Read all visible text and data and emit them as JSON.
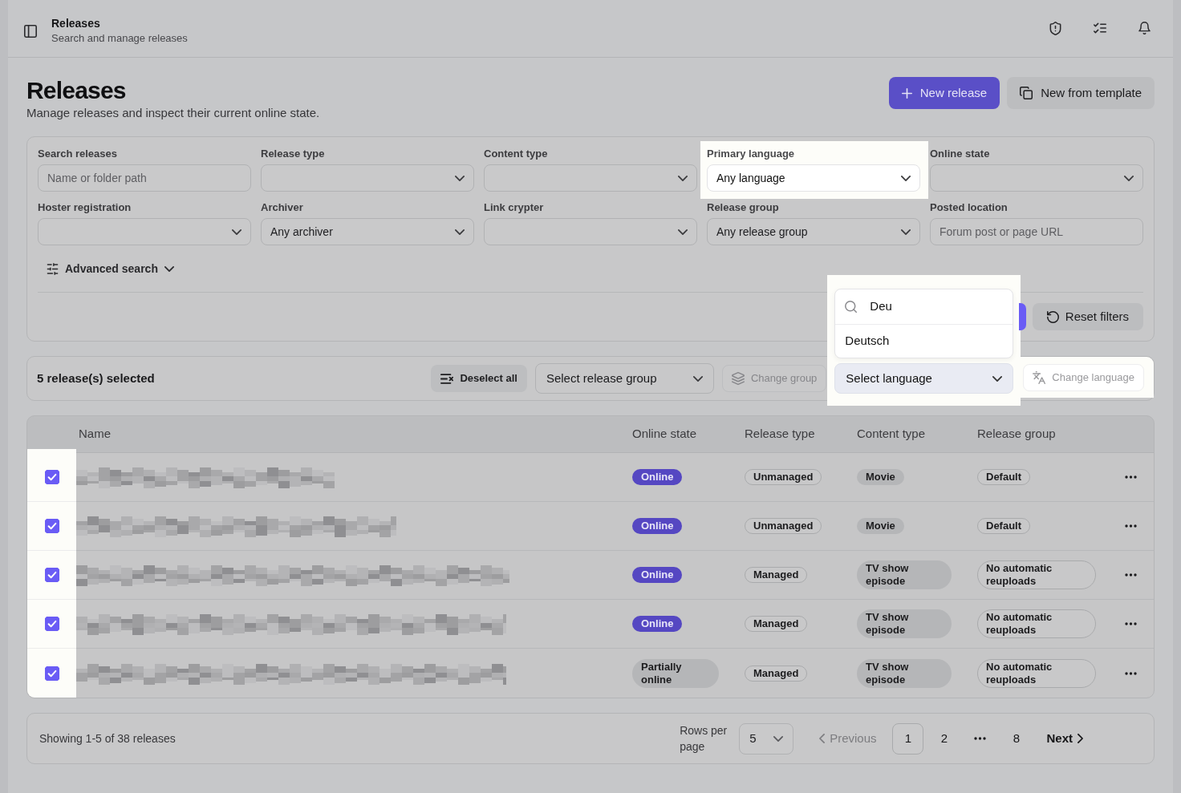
{
  "header": {
    "title": "Releases",
    "subtitle": "Search and manage releases"
  },
  "page": {
    "title": "Releases",
    "description": "Manage releases and inspect their current online state.",
    "actions": [
      {
        "kind": "primary",
        "label": "New release"
      },
      {
        "kind": "secondary",
        "label": "New from template"
      }
    ]
  },
  "filters": {
    "fields": [
      {
        "label": "Search releases",
        "kind": "text",
        "placeholder": "Name or folder path",
        "highlighted": false
      },
      {
        "label": "Release type",
        "kind": "select",
        "highlighted": false
      },
      {
        "label": "Content type",
        "kind": "select",
        "highlighted": false
      },
      {
        "label": "Primary language",
        "kind": "select",
        "value": "Any language",
        "highlighted": true
      },
      {
        "label": "Online state",
        "kind": "select",
        "highlighted": false
      },
      {
        "label": "Hoster registration",
        "kind": "select",
        "highlighted": false
      },
      {
        "label": "Archiver",
        "kind": "select",
        "value": "Any archiver",
        "highlighted": false
      },
      {
        "label": "Link crypter",
        "kind": "select",
        "highlighted": false
      },
      {
        "label": "Release group",
        "kind": "select",
        "value": "Any release group",
        "highlighted": false
      },
      {
        "label": "Posted location",
        "kind": "text",
        "placeholder": "Forum post or page URL",
        "highlighted": false
      }
    ],
    "advanced_search": {
      "label": "Advanced search",
      "expanded": false
    },
    "reset_button": "Reset filters"
  },
  "bulk_bar": {
    "selection_text": "5 release(s) selected",
    "actions": [
      {
        "kind": "button",
        "label": "Deselect all",
        "disabled": false,
        "highlighted": false
      },
      {
        "kind": "select",
        "value": "Select release group",
        "highlighted": false
      },
      {
        "kind": "button",
        "label": "Change group",
        "disabled": true,
        "highlighted": false
      },
      {
        "kind": "select",
        "value": "Select language",
        "highlighted": true,
        "dropdown": {
          "search": "Deu",
          "options": [
            "Deutsch"
          ]
        }
      },
      {
        "kind": "button",
        "label": "Change language",
        "disabled": true,
        "highlighted": true
      }
    ]
  },
  "table": {
    "columns": [
      "Name",
      "Online state",
      "Release type",
      "Content type",
      "Release group"
    ],
    "select_column_highlighted": true,
    "rows": [
      {
        "selected": true,
        "online_state": {
          "label": "Online",
          "kind": "accent"
        },
        "release_type": {
          "label": "Unmanaged",
          "kind": "outline"
        },
        "content_type": {
          "label": "Movie",
          "kind": "filled"
        },
        "release_group": {
          "label": "Default",
          "kind": "outline"
        }
      },
      {
        "selected": true,
        "online_state": {
          "label": "Online",
          "kind": "accent"
        },
        "release_type": {
          "label": "Unmanaged",
          "kind": "outline"
        },
        "content_type": {
          "label": "Movie",
          "kind": "filled"
        },
        "release_group": {
          "label": "Default",
          "kind": "outline"
        }
      },
      {
        "selected": true,
        "online_state": {
          "label": "Online",
          "kind": "accent"
        },
        "release_type": {
          "label": "Managed",
          "kind": "outline"
        },
        "content_type": {
          "label": "TV show episode",
          "kind": "filled"
        },
        "release_group": {
          "label": "No automatic reuploads",
          "kind": "outline"
        }
      },
      {
        "selected": true,
        "online_state": {
          "label": "Online",
          "kind": "accent"
        },
        "release_type": {
          "label": "Managed",
          "kind": "outline"
        },
        "content_type": {
          "label": "TV show episode",
          "kind": "filled"
        },
        "release_group": {
          "label": "No automatic reuploads",
          "kind": "outline"
        }
      },
      {
        "selected": true,
        "online_state": {
          "label": "Partially online",
          "kind": "filled"
        },
        "release_type": {
          "label": "Managed",
          "kind": "outline"
        },
        "content_type": {
          "label": "TV show episode",
          "kind": "filled"
        },
        "release_group": {
          "label": "No automatic reuploads",
          "kind": "outline"
        }
      }
    ]
  },
  "pagination": {
    "summary": "Showing 1-5 of 38 releases",
    "rows_per_page_label": "Rows per page",
    "rows_per_page": "5",
    "previous": {
      "label": "Previous",
      "disabled": true
    },
    "pages": [
      {
        "kind": "page",
        "label": "1",
        "selected": true
      },
      {
        "kind": "page",
        "label": "2",
        "selected": false
      },
      {
        "kind": "ellipsis"
      },
      {
        "kind": "page",
        "label": "8",
        "selected": false
      }
    ],
    "next": {
      "label": "Next",
      "disabled": false
    }
  }
}
